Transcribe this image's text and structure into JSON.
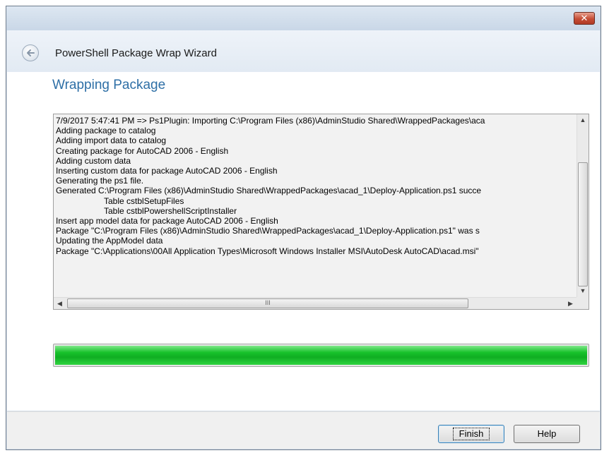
{
  "window": {
    "close_icon": "close-icon",
    "close_glyph": "✕"
  },
  "header": {
    "title": "PowerShell Package Wrap Wizard",
    "back_icon": "back-arrow-icon"
  },
  "page": {
    "heading": "Wrapping Package"
  },
  "log": {
    "lines": [
      {
        "text": "7/9/2017 5:47:41 PM => Ps1Plugin: Importing C:\\Program Files (x86)\\AdminStudio Shared\\WrappedPackages\\aca",
        "indent": false
      },
      {
        "text": "Adding package to catalog",
        "indent": false
      },
      {
        "text": "Adding import data to catalog",
        "indent": false
      },
      {
        "text": "Creating package for AutoCAD 2006 - English",
        "indent": false
      },
      {
        "text": "Adding custom data",
        "indent": false
      },
      {
        "text": "Inserting custom data for package AutoCAD 2006 - English",
        "indent": false
      },
      {
        "text": "Generating the ps1 file.",
        "indent": false
      },
      {
        "text": "Generated C:\\Program Files (x86)\\AdminStudio Shared\\WrappedPackages\\acad_1\\Deploy-Application.ps1 succe",
        "indent": false
      },
      {
        "text": "Table cstblSetupFiles",
        "indent": true
      },
      {
        "text": "Table cstblPowershellScriptInstaller",
        "indent": true
      },
      {
        "text": "Insert app model data for package AutoCAD 2006 - English",
        "indent": false
      },
      {
        "text": "Package \"C:\\Program Files (x86)\\AdminStudio Shared\\WrappedPackages\\acad_1\\Deploy-Application.ps1\" was s",
        "indent": false
      },
      {
        "text": "Updating the AppModel data",
        "indent": false
      },
      {
        "text": "Package \"C:\\Applications\\00All Application Types\\Microsoft Windows Installer MSI\\AutoDesk AutoCAD\\acad.msi\"",
        "indent": false
      }
    ]
  },
  "scrollbars": {
    "up_glyph": "▲",
    "down_glyph": "▼",
    "left_glyph": "◀",
    "right_glyph": "▶",
    "grip_glyph": "≡",
    "hgrip_glyph": "III"
  },
  "progress": {
    "value": 1.0,
    "color": "#1bc12e"
  },
  "footer": {
    "finish_label": "Finish",
    "help_label": "Help"
  }
}
